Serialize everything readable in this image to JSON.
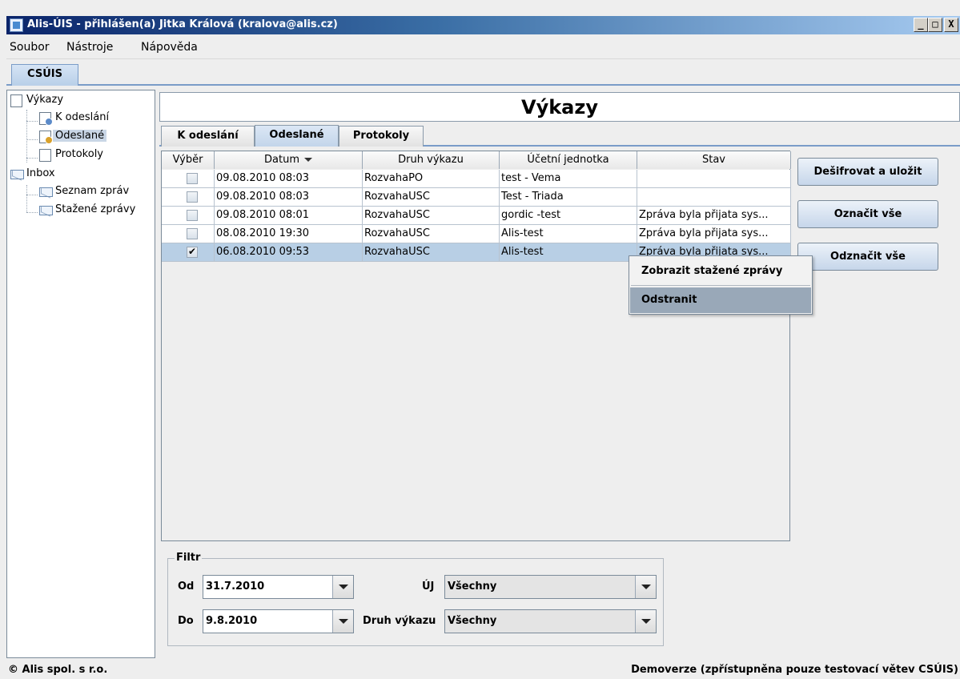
{
  "window": {
    "title": "Alis-ÚIS - přihlášen(a) Jitka Králová (kralova@alis.cz)",
    "controls": [
      "_",
      "□",
      "X"
    ]
  },
  "menu": [
    "Soubor",
    "Nástroje",
    "Nápověda"
  ],
  "top_tab": "CSÚIS",
  "tree": {
    "vykazy": "Výkazy",
    "k_odeslani": "K odeslání",
    "odeslane": "Odeslané",
    "protokoly": "Protokoly",
    "inbox": "Inbox",
    "seznam_zprav": "Seznam zpráv",
    "stazene_zpravy": "Stažené zprávy"
  },
  "heading": "Výkazy",
  "subtabs": [
    "K odeslání",
    "Odeslané",
    "Protokoly"
  ],
  "table": {
    "columns": [
      "Výběr",
      "Datum",
      "Druh výkazu",
      "Účetní jednotka",
      "Stav"
    ],
    "rows": [
      {
        "checked": "",
        "datum": "09.08.2010 08:03",
        "druh": "RozvahaPO",
        "jednotka": "test - Vema",
        "stav": ""
      },
      {
        "checked": "",
        "datum": "09.08.2010 08:03",
        "druh": "RozvahaUSC",
        "jednotka": "Test - Triada",
        "stav": ""
      },
      {
        "checked": "",
        "datum": "09.08.2010 08:01",
        "druh": "RozvahaUSC",
        "jednotka": "gordic -test",
        "stav": "Zpráva byla přijata sys..."
      },
      {
        "checked": "",
        "datum": "08.08.2010 19:30",
        "druh": "RozvahaUSC",
        "jednotka": "Alis-test",
        "stav": "Zpráva byla přijata sys..."
      },
      {
        "checked": "✔",
        "datum": "06.08.2010 09:53",
        "druh": "RozvahaUSC",
        "jednotka": "Alis-test",
        "stav": "Zpráva byla přijata sys..."
      }
    ]
  },
  "buttons": {
    "desifrovat": "Dešifrovat a uložit",
    "oznacit": "Označit vše",
    "odznacit": "Odznačit vše"
  },
  "context_menu": [
    "Zobrazit stažené zprávy",
    "Odstranit"
  ],
  "filter": {
    "legend": "Filtr",
    "od_label": "Od",
    "od_value": "31.7.2010",
    "do_label": "Do",
    "do_value": "9.8.2010",
    "uj_label": "ÚJ",
    "uj_value": "Všechny",
    "druh_label": "Druh výkazu",
    "druh_value": "Všechny"
  },
  "status": {
    "left": "© Alis spol. s r.o.",
    "right": "Demoverze (zpřístupněna pouze testovací větev CSÚIS)"
  }
}
